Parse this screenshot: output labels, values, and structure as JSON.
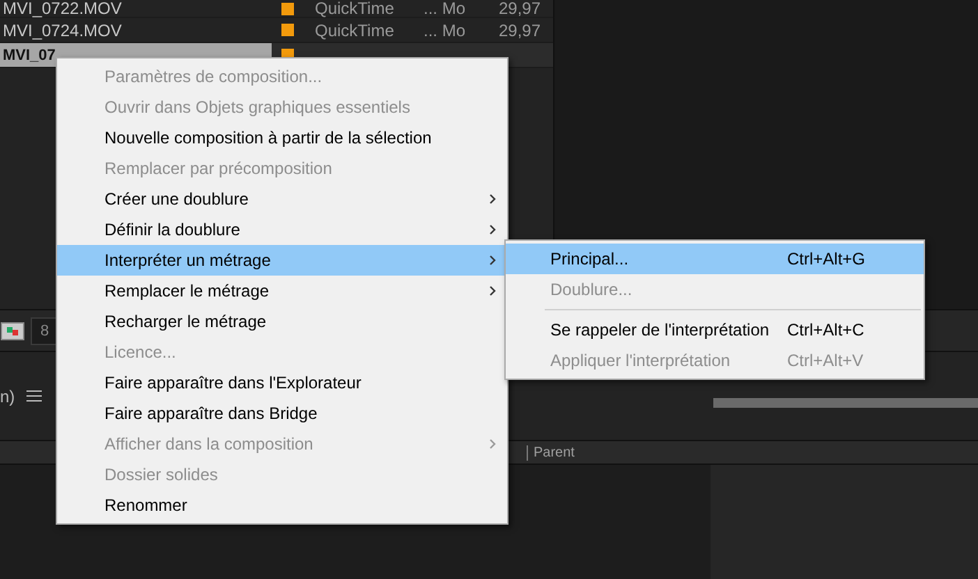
{
  "project_rows": [
    {
      "name": "MVI_0722.MOV",
      "color": "#f29a0c",
      "type": "QuickTime",
      "size": "... Mo",
      "fps": "29,97",
      "selected": false
    },
    {
      "name": "MVI_0724.MOV",
      "color": "#f29a0c",
      "type": "QuickTime",
      "size": "... Mo",
      "fps": "29,97",
      "selected": false
    },
    {
      "name": "MVI_07",
      "color": "#f29a0c",
      "selected": true
    }
  ],
  "toolbar": {
    "field_value": "8"
  },
  "timeline": {
    "tab_label": "n)",
    "column_header": "Parent"
  },
  "context_menu": [
    {
      "label": "Paramètres de composition...",
      "disabled": true,
      "submenu": false,
      "selected": false
    },
    {
      "label": "Ouvrir dans Objets graphiques essentiels",
      "disabled": true,
      "submenu": false,
      "selected": false
    },
    {
      "label": "Nouvelle composition à partir de la sélection",
      "disabled": false,
      "submenu": false,
      "selected": false
    },
    {
      "label": "Remplacer par précomposition",
      "disabled": true,
      "submenu": false,
      "selected": false
    },
    {
      "label": "Créer une doublure",
      "disabled": false,
      "submenu": true,
      "selected": false
    },
    {
      "label": "Définir la doublure",
      "disabled": false,
      "submenu": true,
      "selected": false
    },
    {
      "label": "Interpréter un métrage",
      "disabled": false,
      "submenu": true,
      "selected": true
    },
    {
      "label": "Remplacer le métrage",
      "disabled": false,
      "submenu": true,
      "selected": false
    },
    {
      "label": "Recharger le métrage",
      "disabled": false,
      "submenu": false,
      "selected": false
    },
    {
      "label": "Licence...",
      "disabled": true,
      "submenu": false,
      "selected": false
    },
    {
      "label": "Faire apparaître dans l'Explorateur",
      "disabled": false,
      "submenu": false,
      "selected": false
    },
    {
      "label": "Faire apparaître dans Bridge",
      "disabled": false,
      "submenu": false,
      "selected": false
    },
    {
      "label": "Afficher dans la composition",
      "disabled": true,
      "submenu": true,
      "selected": false
    },
    {
      "label": "Dossier solides",
      "disabled": true,
      "submenu": false,
      "selected": false
    },
    {
      "label": "Renommer",
      "disabled": false,
      "submenu": false,
      "selected": false
    }
  ],
  "submenu": [
    {
      "kind": "item",
      "label": "Principal...",
      "shortcut": "Ctrl+Alt+G",
      "disabled": false,
      "selected": true
    },
    {
      "kind": "item",
      "label": "Doublure...",
      "disabled": true,
      "selected": false
    },
    {
      "kind": "separator"
    },
    {
      "kind": "item",
      "label": "Se rappeler de l'interprétation",
      "shortcut": "Ctrl+Alt+C",
      "disabled": false,
      "selected": false
    },
    {
      "kind": "item",
      "label": "Appliquer l'interprétation",
      "shortcut": "Ctrl+Alt+V",
      "disabled": true,
      "selected": false
    }
  ]
}
